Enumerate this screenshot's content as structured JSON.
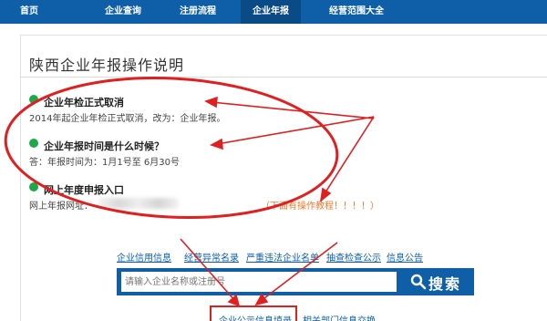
{
  "nav": {
    "items": [
      {
        "label": "首页"
      },
      {
        "label": "企业查询"
      },
      {
        "label": "注册流程"
      },
      {
        "label": "企业年报"
      },
      {
        "label": "经营范围大全"
      }
    ]
  },
  "page": {
    "title": "陕西企业年报操作说明"
  },
  "items": [
    {
      "heading": "企业年检正式取消",
      "text": "2014年起企业年检正式取消，改为：企业年报。"
    },
    {
      "heading": "企业年报时间是什么时候？",
      "text": "答：年报时间为：1月1号至 6月30号"
    },
    {
      "heading": "网上年度申报入口",
      "text": "网上年报网址：",
      "note": "（下面有操作教程！！！！）"
    }
  ],
  "links": [
    {
      "label": "企业信用信息"
    },
    {
      "label": "经营异常名录"
    },
    {
      "label": "严重违法企业名单"
    },
    {
      "label": "抽查检查公示"
    },
    {
      "label": "信息公告"
    }
  ],
  "search": {
    "placeholder": "请输入企业名称或注册号",
    "button_label": "搜索",
    "icon": "search-icon"
  },
  "bottom_links": [
    {
      "label": "企业公示信息填录"
    },
    {
      "label": "相关部门信息交换"
    }
  ],
  "colors": {
    "nav_bg": "#0e5fa8",
    "nav_active": "#0a4a86",
    "dot": "#1ea84a",
    "link": "#0e5fa8",
    "note": "#ec7b2c",
    "annotation": "#e02020"
  }
}
